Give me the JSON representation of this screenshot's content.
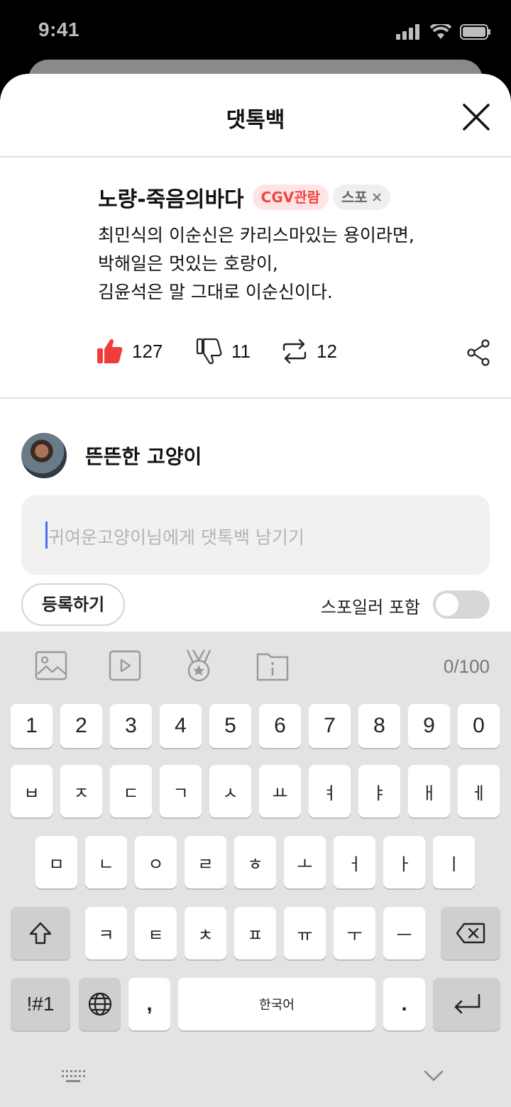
{
  "status": {
    "time": "9:41"
  },
  "header": {
    "title": "댓톡백"
  },
  "review": {
    "title": "노량-죽음의바다",
    "badge_cgv": "CGV관람",
    "badge_spoiler": "스포",
    "lines": [
      "최민식의 이순신은 카리스마있는 용이라면,",
      "박해일은 멋있는 호랑이,",
      "김윤석은 말 그대로 이순신이다."
    ],
    "likes": "127",
    "dislikes": "11",
    "reposts": "12",
    "liked": true
  },
  "writer": {
    "name": "뜬뜬한 고양이"
  },
  "comment": {
    "placeholder": "귀여운고양이님에게 댓톡백 남기기",
    "char_count": "0/100"
  },
  "footer": {
    "register_label": "등록하기",
    "spoiler_label": "스포일러 포함",
    "spoiler_on": false
  },
  "keyboard": {
    "row1": [
      "1",
      "2",
      "3",
      "4",
      "5",
      "6",
      "7",
      "8",
      "9",
      "0"
    ],
    "row2": [
      "ㅂ",
      "ㅈ",
      "ㄷ",
      "ㄱ",
      "ㅅ",
      "ㅛ",
      "ㅕ",
      "ㅑ",
      "ㅐ",
      "ㅔ"
    ],
    "row3": [
      "ㅁ",
      "ㄴ",
      "ㅇ",
      "ㄹ",
      "ㅎ",
      "ㅗ",
      "ㅓ",
      "ㅏ",
      "ㅣ"
    ],
    "row4": [
      "ㅋ",
      "ㅌ",
      "ㅊ",
      "ㅍ",
      "ㅠ",
      "ㅜ",
      "ㅡ"
    ],
    "symbols_label": "!#1",
    "comma": ",",
    "space_label": "한국어",
    "period": "."
  },
  "colors": {
    "accent": "#f04646",
    "toggle_off": "#d7d7d7",
    "caret": "#4a6cf7"
  }
}
